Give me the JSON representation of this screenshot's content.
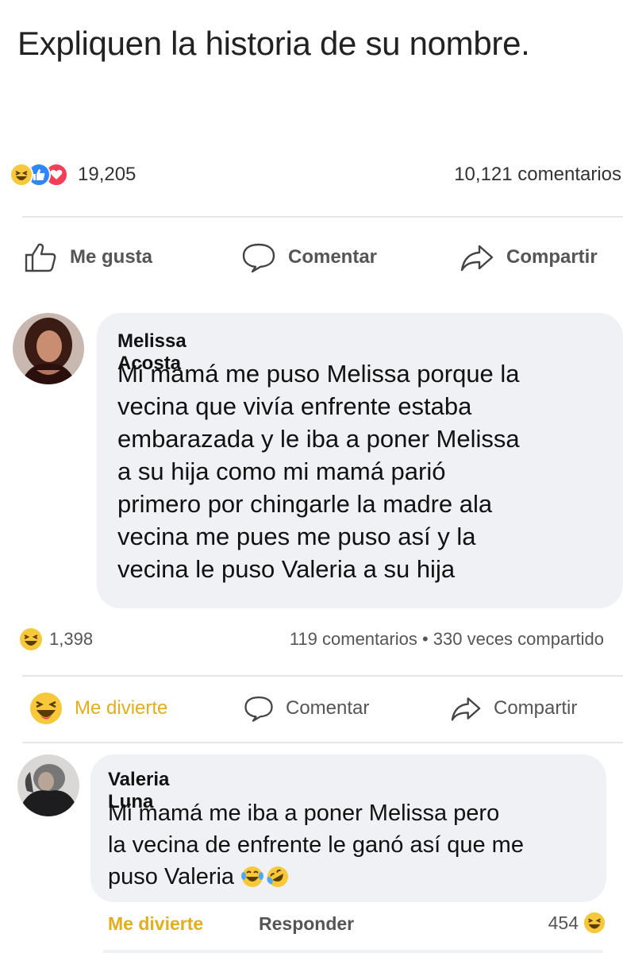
{
  "post": {
    "title": "Expliquen la historia de su nombre.",
    "reaction_count": "19,205",
    "comment_count": "10,121 comentarios",
    "reactions": [
      "haha-reaction",
      "like-reaction",
      "love-reaction"
    ]
  },
  "post_actions": {
    "like": "Me gusta",
    "comment": "Comentar",
    "share": "Compartir"
  },
  "comments": [
    {
      "author": "Melissa Acosta",
      "text_lines": [
        "Mi mamá me puso Melissa porque la",
        "vecina que vivía enfrente estaba",
        "embarazada y le iba a poner Melissa",
        "a su hija como mi mamá parió",
        "primero por chingarle la madre ala",
        "vecina me pues me puso así y la",
        "vecina le puso Valeria a su hija"
      ],
      "reaction_count": "1,398",
      "stats": "119 comentarios • 330 veces compartido",
      "actions": {
        "react": "Me divierte",
        "comment": "Comentar",
        "share": "Compartir"
      }
    },
    {
      "author": "Valeria Luna",
      "text_lines": [
        "Mi mamá me iba a poner Melissa pero",
        "la vecina de enfrente le ganó así que me",
        "puso Valeria"
      ],
      "emojis": [
        "laughing-tears-emoji",
        "rolling-laughing-emoji"
      ],
      "actions": {
        "react": "Me divierte",
        "reply": "Responder"
      },
      "reaction_count": "454"
    }
  ],
  "colors": {
    "haha": "#f7c93a",
    "like": "#2d88ff",
    "love": "#f33e58",
    "react_active": "#e4ad1c",
    "bubble_bg": "#f0f1f4"
  }
}
